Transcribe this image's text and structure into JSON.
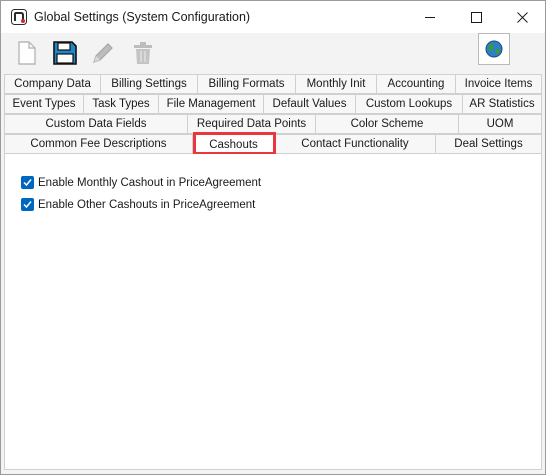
{
  "window": {
    "title": "Global Settings (System Configuration)",
    "controls": [
      "minimize-icon",
      "maximize-icon",
      "close-icon"
    ]
  },
  "toolbar": {
    "buttons": [
      {
        "icon": "new-document-icon",
        "enabled": false
      },
      {
        "icon": "save-icon",
        "enabled": true
      },
      {
        "icon": "edit-pencil-icon",
        "enabled": false
      },
      {
        "icon": "delete-trash-icon",
        "enabled": false
      }
    ],
    "globe_button": {
      "icon": "globe-icon"
    }
  },
  "tabs": {
    "rows": [
      [
        "Company Data",
        "Billing Settings",
        "Billing Formats",
        "Monthly Init",
        "Accounting",
        "Invoice Items"
      ],
      [
        "Event Types",
        "Task Types",
        "File Management",
        "Default Values",
        "Custom Lookups",
        "AR Statistics"
      ],
      [
        "Custom Data Fields",
        "Required Data Points",
        "Color Scheme",
        "UOM"
      ],
      [
        "Common Fee Descriptions",
        "Cashouts",
        "Contact Functionality",
        "Deal Settings"
      ]
    ],
    "active": "Cashouts",
    "highlight_color": "#e8383d"
  },
  "cashouts": {
    "options": [
      {
        "label": "Enable Monthly Cashout in PriceAgreement",
        "checked": true
      },
      {
        "label": "Enable Other Cashouts in PriceAgreement",
        "checked": true
      }
    ]
  },
  "colors": {
    "accent": "#0067c0"
  }
}
